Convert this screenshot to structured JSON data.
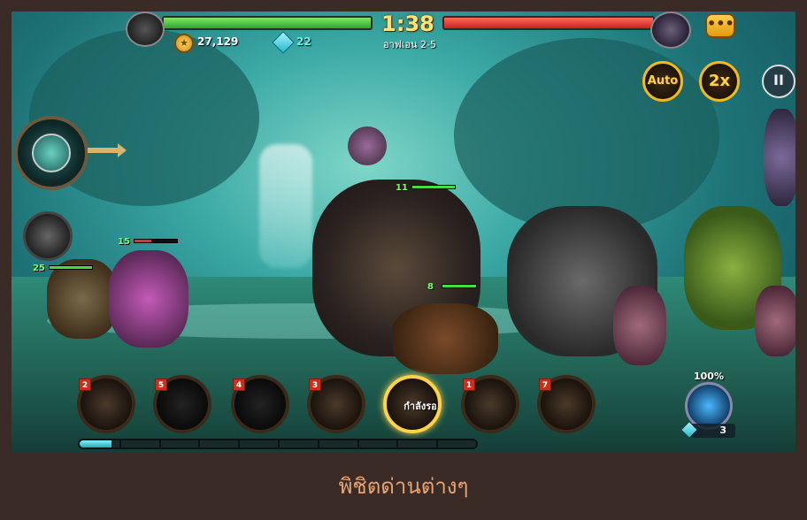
{
  "top_bar": {
    "timer": "1:38",
    "stage": "อาฟเอน 2-5",
    "coins": "27,129",
    "gems": "22",
    "player_hp": 1.0,
    "enemy_hp": 1.0,
    "chat_label": "•••"
  },
  "controls": {
    "auto_label": "Auto",
    "speed_label": "2x",
    "pause_label": "II"
  },
  "units": {
    "ally1_level": "15",
    "ally2_level": "25",
    "enemy_boss_level": "11",
    "enemy_unit_level": "8"
  },
  "hero_bar": {
    "slots": [
      {
        "level": "2"
      },
      {
        "level": "5"
      },
      {
        "level": "4"
      },
      {
        "level": "3"
      },
      {
        "level": ""
      },
      {
        "level": "1"
      },
      {
        "level": "7"
      }
    ],
    "waiting_label": "กำลังรอ",
    "potion_percent": "100%",
    "potion_cost": "3",
    "mana_fraction": 0.08
  },
  "caption": "พิชิตด่านต่างๆ",
  "colors": {
    "ally_hp": "#2fa52a",
    "enemy_hp": "#c8231c",
    "accent": "#f2b920"
  }
}
